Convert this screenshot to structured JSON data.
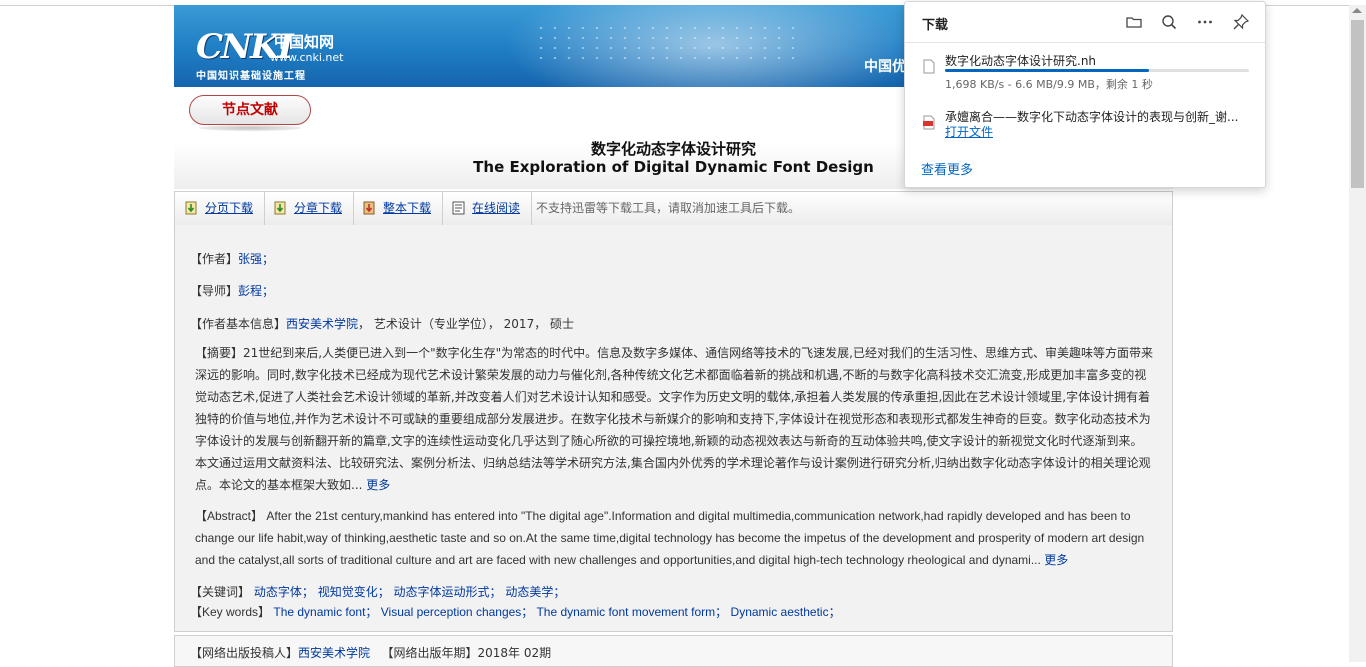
{
  "banner": {
    "logo_main": "CNKI",
    "logo_cn": "中国知网",
    "logo_url": "www.cnki.net",
    "logo_sub": "中国知识基础设施工程",
    "right_text": "中国优"
  },
  "node_label": "节点文献",
  "title_cn": "数字化动态字体设计研究",
  "title_en": "The Exploration of Digital Dynamic Font Design",
  "toolbar": {
    "buttons": [
      {
        "label": "分页下载",
        "icon": "download-page-icon"
      },
      {
        "label": "分章下载",
        "icon": "download-chapter-icon"
      },
      {
        "label": "整本下载",
        "icon": "download-book-icon"
      },
      {
        "label": "在线阅读",
        "icon": "read-online-icon"
      }
    ],
    "note": "不支持迅雷等下载工具，请取消加速工具后下载。"
  },
  "meta": {
    "author_label": "【作者】",
    "author": "张强；",
    "mentor_label": "【导师】",
    "mentor": "彭程；",
    "basic_label": "【作者基本信息】",
    "institution": "西安美术学院",
    "basic_rest": "，  艺术设计（专业学位），  2017，  硕士"
  },
  "abstract_cn": {
    "label": "【摘要】",
    "text": "21世纪到来后,人类便已进入到一个\"数字化生存\"为常态的时代中。信息及数字多媒体、通信网络等技术的飞速发展,已经对我们的生活习性、思维方式、审美趣味等方面带来深远的影响。同时,数字化技术已经成为现代艺术设计繁荣发展的动力与催化剂,各种传统文化艺术都面临着新的挑战和机遇,不断的与数字化高科技术交汇流变,形成更加丰富多变的视觉动态艺术,促进了人类社会艺术设计领域的革新,并改变着人们对艺术设计认知和感受。文字作为历史文明的载体,承担着人类发展的传承重担,因此在艺术设计领域里,字体设计拥有着独特的价值与地位,并作为艺术设计不可或缺的重要组成部分发展进步。在数字化技术与新媒介的影响和支持下,字体设计在视觉形态和表现形式都发生神奇的巨变。数字化动态技术为字体设计的发展与创新翻开新的篇章,文字的连续性运动变化几乎达到了随心所欲的可操控境地,新颖的动态视效表达与新奇的互动体验共鸣,使文字设计的新视觉文化时代逐渐到来。本文通过运用文献资料法、比较研究法、案例分析法、归纳总结法等学术研究方法,集合国内外优秀的学术理论著作与设计案例进行研究分析,归纳出数字化动态字体设计的相关理论观点。本论文的基本框架大致如...",
    "more": "更多"
  },
  "abstract_en": {
    "label": "【Abstract】",
    "text": "After the 21st century,mankind has entered into \"The digital age\".Information and digital multimedia,communication network,had rapidly developed and has been to change our life habit,way of thinking,aesthetic taste and so on.At the same time,digital technology has become the impetus of the development and prosperity of modern art design and the catalyst,all sorts of traditional culture and art are faced with new challenges and opportunities,and digital high-tech technology rheological and dynami...",
    "more": "更多"
  },
  "keywords_cn": {
    "label": "【关键词】",
    "items": [
      "动态字体；",
      "视知觉变化；",
      "动态字体运动形式；",
      "动态美学；"
    ]
  },
  "keywords_en": {
    "label": "【Key words】",
    "items": [
      "The dynamic font；",
      "Visual perception changes；",
      "The dynamic font movement form；",
      "Dynamic aesthetic；"
    ]
  },
  "publish": {
    "submitter_label": "【网络出版投稿人】",
    "submitter": "西安美术学院",
    "year_label": "【网络出版年期】",
    "year": "2018年 02期"
  },
  "downloads": {
    "title": "下载",
    "icons": [
      "folder-icon",
      "search-icon",
      "more-icon",
      "pin-icon"
    ],
    "items": [
      {
        "name": "数字化动态字体设计研究.nh",
        "status": "1,698 KB/s - 6.6 MB/9.9 MB，剩余 1 秒",
        "progress": 0.67
      },
      {
        "name": "承嬗离合——数字化下动态字体设计的表现与创新_谢...",
        "action": "打开文件"
      }
    ],
    "more": "查看更多"
  }
}
